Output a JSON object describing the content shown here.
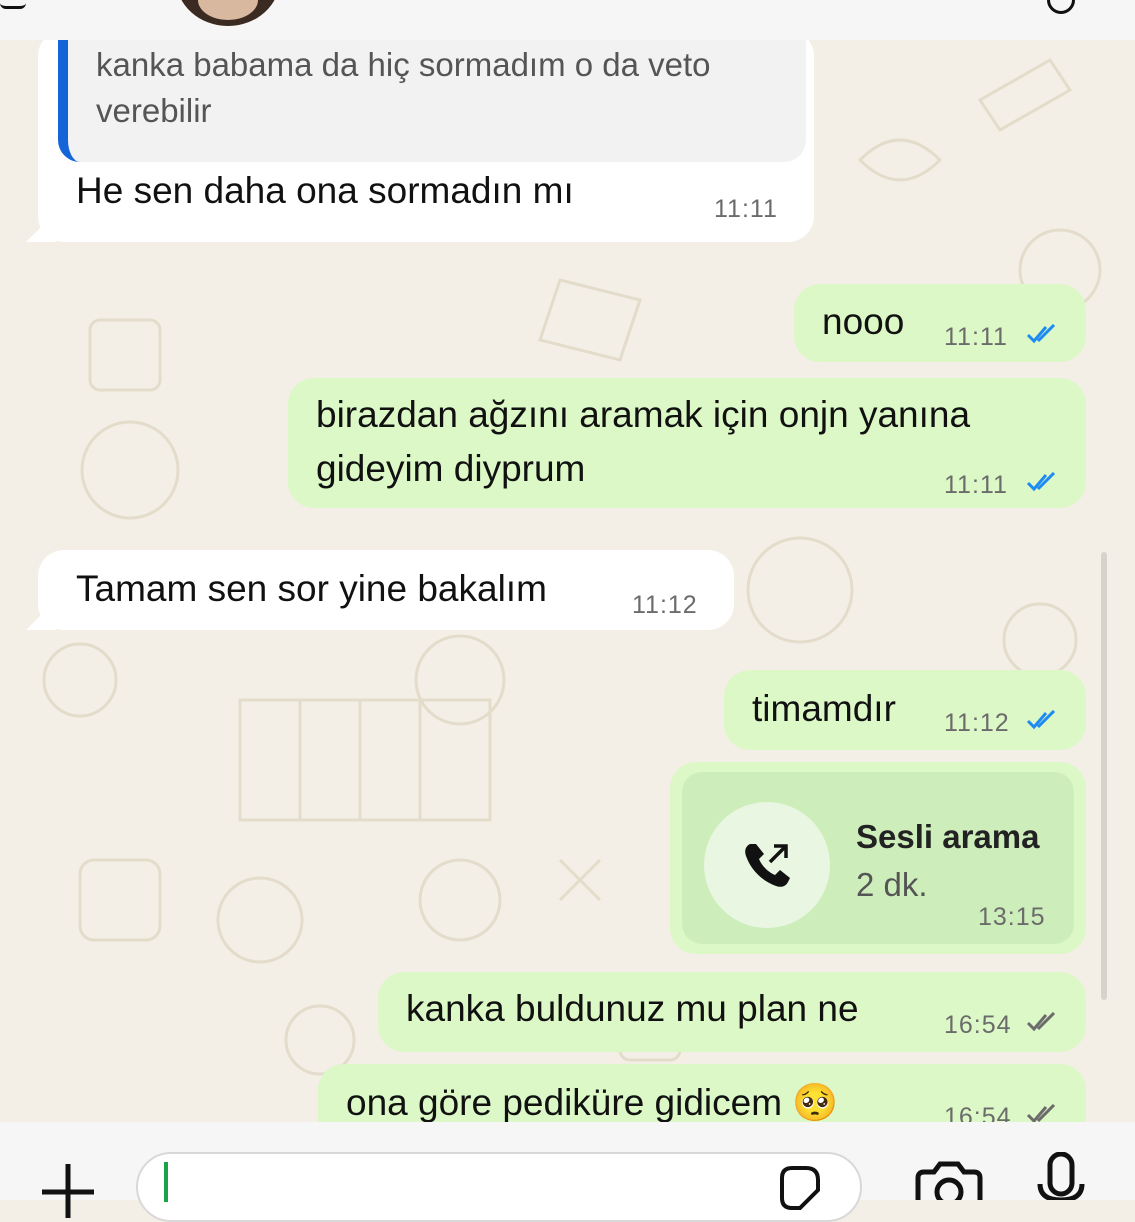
{
  "quote": {
    "text": "kanka babama da hiç sormadım o da veto verebilir"
  },
  "messages": [
    {
      "text": "He sen daha ona sormadın mı",
      "time": "11:11"
    },
    {
      "text": "nooo",
      "time": "11:11",
      "ticks": "read"
    },
    {
      "text": "birazdan ağzını aramak için onjn yanına gideyim diyprum",
      "time": "11:11",
      "ticks": "read"
    },
    {
      "text": "Tamam sen sor yine bakalım",
      "time": "11:12"
    },
    {
      "text": "timamdır",
      "time": "11:12",
      "ticks": "read"
    },
    {
      "text": "kanka buldunuz mu plan ne",
      "time": "16:54",
      "ticks": "delivered"
    },
    {
      "text": "ona göre pediküre gidicem 🥺",
      "time": "16:54",
      "ticks": "delivered"
    }
  ],
  "call": {
    "title": "Sesli arama",
    "duration": "2 dk.",
    "time": "13:15"
  },
  "icons": {
    "phone": "outgoing-call-icon",
    "read_tick_color": "#1d8bf3",
    "delivered_tick_color": "#6b6b6b"
  },
  "colors": {
    "incoming": "#ffffff",
    "outgoing": "#dcf8c6",
    "background": "#f3efe6",
    "quote_bar": "#1565d8"
  }
}
